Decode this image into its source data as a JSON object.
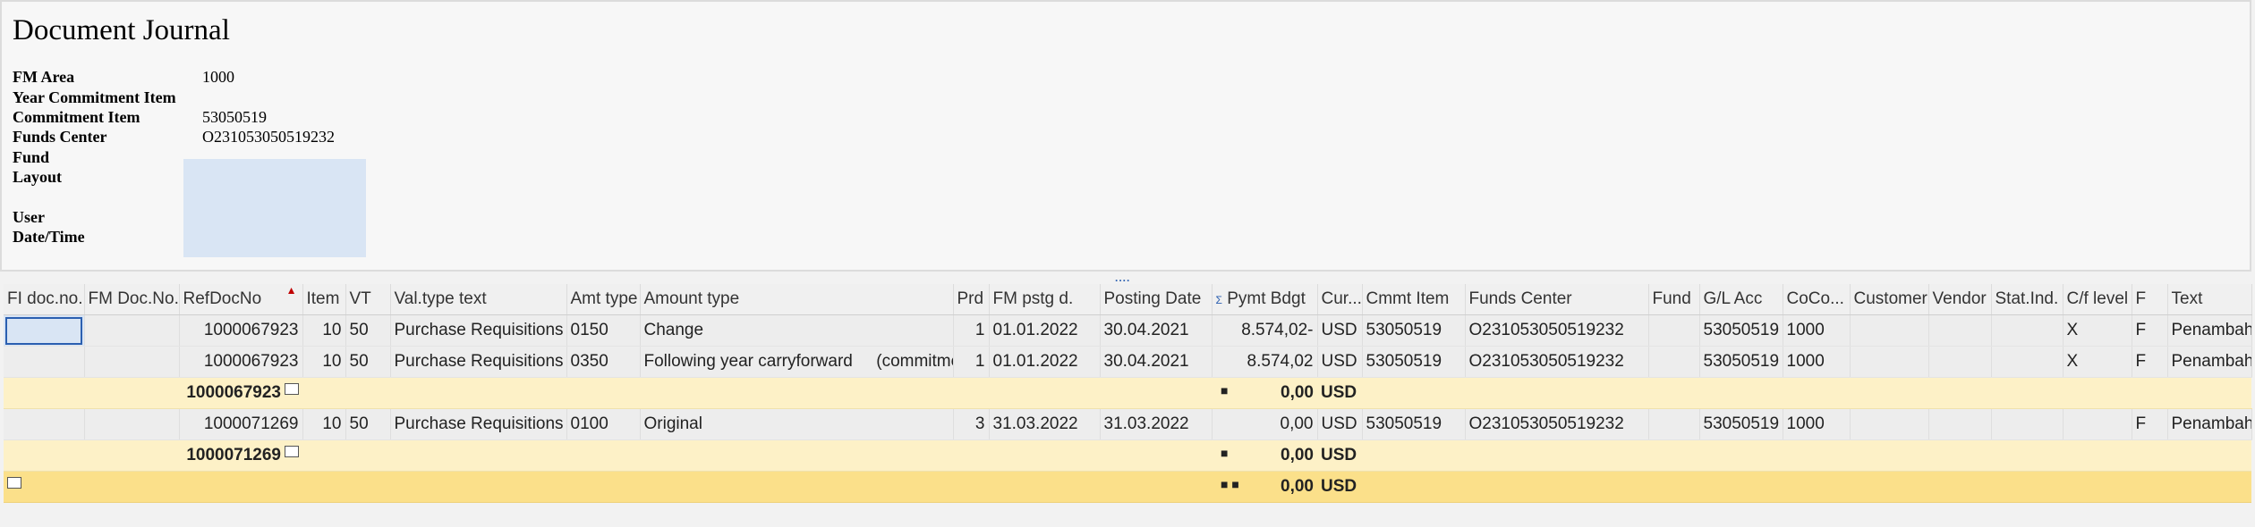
{
  "title": "Document Journal",
  "header_fields": [
    {
      "label": "FM Area",
      "value": "1000"
    },
    {
      "label": "Year Commitment Item",
      "value": ""
    },
    {
      "label": "Commitment Item",
      "value": "53050519"
    },
    {
      "label": "Funds Center",
      "value": "O231053050519232"
    },
    {
      "label": "Fund",
      "value": ""
    },
    {
      "label": "Layout",
      "value": ""
    },
    {
      "label": "User",
      "value": ""
    },
    {
      "label": "Date/Time",
      "value": ""
    }
  ],
  "splitter_glyph": "....",
  "columns": [
    "FI doc.no.",
    "FM Doc.No.",
    "RefDocNo",
    "Item",
    "VT",
    "Val.type text",
    "Amt type",
    "Amount type",
    "Prd",
    "FM pstg d.",
    "Posting Date",
    "Pymt Bdgt",
    "Cur...",
    "Cmmt Item",
    "Funds Center",
    "Fund",
    "G/L Acc",
    "CoCo...",
    "Customer",
    "Vendor",
    "Stat.Ind.",
    "C/f level",
    "F",
    "Text"
  ],
  "sum_marker": "Σ",
  "sort_marker": "▲",
  "rows": [
    {
      "type": "data",
      "fi": "",
      "fm": "",
      "ref": "1000067923",
      "item": "10",
      "vt": "50",
      "vttext": "Purchase Requisitions",
      "amt": "0150",
      "amttext": "Change",
      "prd": "1",
      "fmdate": "01.01.2022",
      "postdate": "30.04.2021",
      "pymt": "8.574,02-",
      "cur": "USD",
      "cmmt": "53050519",
      "fc": "O231053050519232",
      "fund": "",
      "gl": "53050519",
      "coco": "1000",
      "cust": "",
      "vend": "",
      "stat": "",
      "cf": "X",
      "f": "F",
      "text": "Penambah"
    },
    {
      "type": "data",
      "fi": "",
      "fm": "",
      "ref": "1000067923",
      "item": "10",
      "vt": "50",
      "vttext": "Purchase Requisitions",
      "amt": "0350",
      "amttext": "Following year carryforward     (commitme",
      "prd": "1",
      "fmdate": "01.01.2022",
      "postdate": "30.04.2021",
      "pymt": "8.574,02",
      "cur": "USD",
      "cmmt": "53050519",
      "fc": "O231053050519232",
      "fund": "",
      "gl": "53050519",
      "coco": "1000",
      "cust": "",
      "vend": "",
      "stat": "",
      "cf": "X",
      "f": "F",
      "text": "Penambah"
    },
    {
      "type": "sub",
      "ref": "1000067923",
      "marker": "■",
      "pymt": "0,00",
      "cur": "USD"
    },
    {
      "type": "data",
      "fi": "",
      "fm": "",
      "ref": "1000071269",
      "item": "10",
      "vt": "50",
      "vttext": "Purchase Requisitions",
      "amt": "0100",
      "amttext": "Original",
      "prd": "3",
      "fmdate": "31.03.2022",
      "postdate": "31.03.2022",
      "pymt": "0,00",
      "cur": "USD",
      "cmmt": "53050519",
      "fc": "O231053050519232",
      "fund": "",
      "gl": "53050519",
      "coco": "1000",
      "cust": "",
      "vend": "",
      "stat": "",
      "cf": "",
      "f": "F",
      "text": "Penambah"
    },
    {
      "type": "sub",
      "ref": "1000071269",
      "marker": "■",
      "pymt": "0,00",
      "cur": "USD"
    },
    {
      "type": "total",
      "ref": "",
      "marker": "■ ■",
      "pymt": "0,00",
      "cur": "USD"
    }
  ]
}
